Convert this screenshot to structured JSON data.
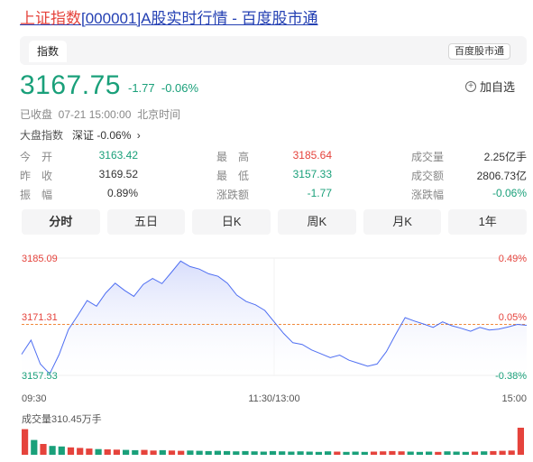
{
  "page": {
    "title_highlight": "上证指数",
    "title_rest": "[000001]A股实时行情 - 百度股市通"
  },
  "tabbar": {
    "active_tab": "指数",
    "source_badge": "百度股市通"
  },
  "quote": {
    "price": "3167.75",
    "change": "-1.77",
    "change_pct": "-0.06%",
    "add_label": "加自选",
    "status": "已收盘  07-21 15:00:00  北京时间",
    "market_label": "大盘指数",
    "market_value": "深证 -0.06%"
  },
  "stats": [
    {
      "label": "今　开",
      "value": "3163.42",
      "color": "green"
    },
    {
      "label": "最　高",
      "value": "3185.64",
      "color": "red"
    },
    {
      "label": "成交量",
      "value": "2.25亿手",
      "color": "dark"
    },
    {
      "label": "昨　收",
      "value": "3169.52",
      "color": "dark"
    },
    {
      "label": "最　低",
      "value": "3157.33",
      "color": "green"
    },
    {
      "label": "成交额",
      "value": "2806.73亿",
      "color": "dark"
    },
    {
      "label": "振　幅",
      "value": "0.89%",
      "color": "dark"
    },
    {
      "label": "涨跌额",
      "value": "-1.77",
      "color": "green"
    },
    {
      "label": "涨跌幅",
      "value": "-0.06%",
      "color": "green"
    }
  ],
  "period_tabs": [
    "分时",
    "五日",
    "日K",
    "周K",
    "月K",
    "1年"
  ],
  "chart_data": {
    "type": "line",
    "y_left_ticks": [
      "3185.09",
      "3171.31",
      "3157.53"
    ],
    "y_right_ticks": [
      "0.49%",
      "0.05%",
      "-0.38%"
    ],
    "x_ticks": [
      "09:30",
      "11:30/13:00",
      "15:00"
    ],
    "ylim": [
      3157.53,
      3185.09
    ],
    "reference_price": 3169.52,
    "volume_label": "成交量310.45万手",
    "series": [
      {
        "values": [
          3162.5,
          3165.8,
          3160.2,
          3157.9,
          3162.4,
          3168.3,
          3171.6,
          3175.1,
          3173.8,
          3176.9,
          3179.2,
          3177.5,
          3176.1,
          3178.9,
          3180.3,
          3179.1,
          3181.7,
          3184.4,
          3183.1,
          3182.5,
          3181.4,
          3180.8,
          3179.2,
          3176.4,
          3174.9,
          3174.1,
          3172.8,
          3170.1,
          3167.4,
          3165.2,
          3164.8,
          3163.5,
          3162.6,
          3161.7,
          3162.3,
          3161.1,
          3160.4,
          3159.7,
          3160.2,
          3163.1,
          3167.2,
          3171.1,
          3170.3,
          3169.6,
          3168.8,
          3170.1,
          3169.2,
          3168.6,
          3167.9,
          3168.8,
          3168.2,
          3168.4,
          3168.9,
          3169.5,
          3169.3
        ]
      }
    ],
    "volume": {
      "values": [
        9.0,
        5.2,
        3.8,
        3.1,
        2.9,
        2.6,
        2.4,
        2.2,
        2.0,
        1.9,
        1.8,
        1.7,
        1.6,
        1.7,
        1.5,
        1.6,
        1.5,
        1.4,
        1.5,
        1.4,
        1.3,
        1.4,
        1.3,
        1.2,
        1.3,
        1.2,
        1.1,
        1.3,
        1.2,
        1.1,
        1.2,
        1.1,
        1.0,
        1.2,
        1.1,
        1.0,
        1.1,
        1.0,
        1.1,
        1.2,
        1.3,
        1.2,
        1.1,
        1.0,
        1.1,
        1.0,
        1.2,
        1.1,
        1.0,
        1.1,
        1.2,
        1.3,
        1.4,
        1.5,
        9.5
      ],
      "up": [
        1,
        0,
        1,
        0,
        0,
        1,
        1,
        1,
        0,
        1,
        1,
        0,
        0,
        1,
        1,
        0,
        1,
        1,
        0,
        0,
        0,
        0,
        0,
        0,
        0,
        0,
        0,
        0,
        0,
        0,
        0,
        0,
        0,
        0,
        1,
        0,
        0,
        0,
        1,
        1,
        1,
        1,
        0,
        0,
        0,
        1,
        0,
        0,
        0,
        1,
        0,
        1,
        1,
        1,
        1
      ]
    }
  },
  "colors": {
    "up": "#e5433c",
    "down": "#1aa07a",
    "line": "#4e6ef2",
    "fill_top": "#d6dcfb",
    "ref_line": "#f08a3c",
    "link": "#2440b3"
  }
}
